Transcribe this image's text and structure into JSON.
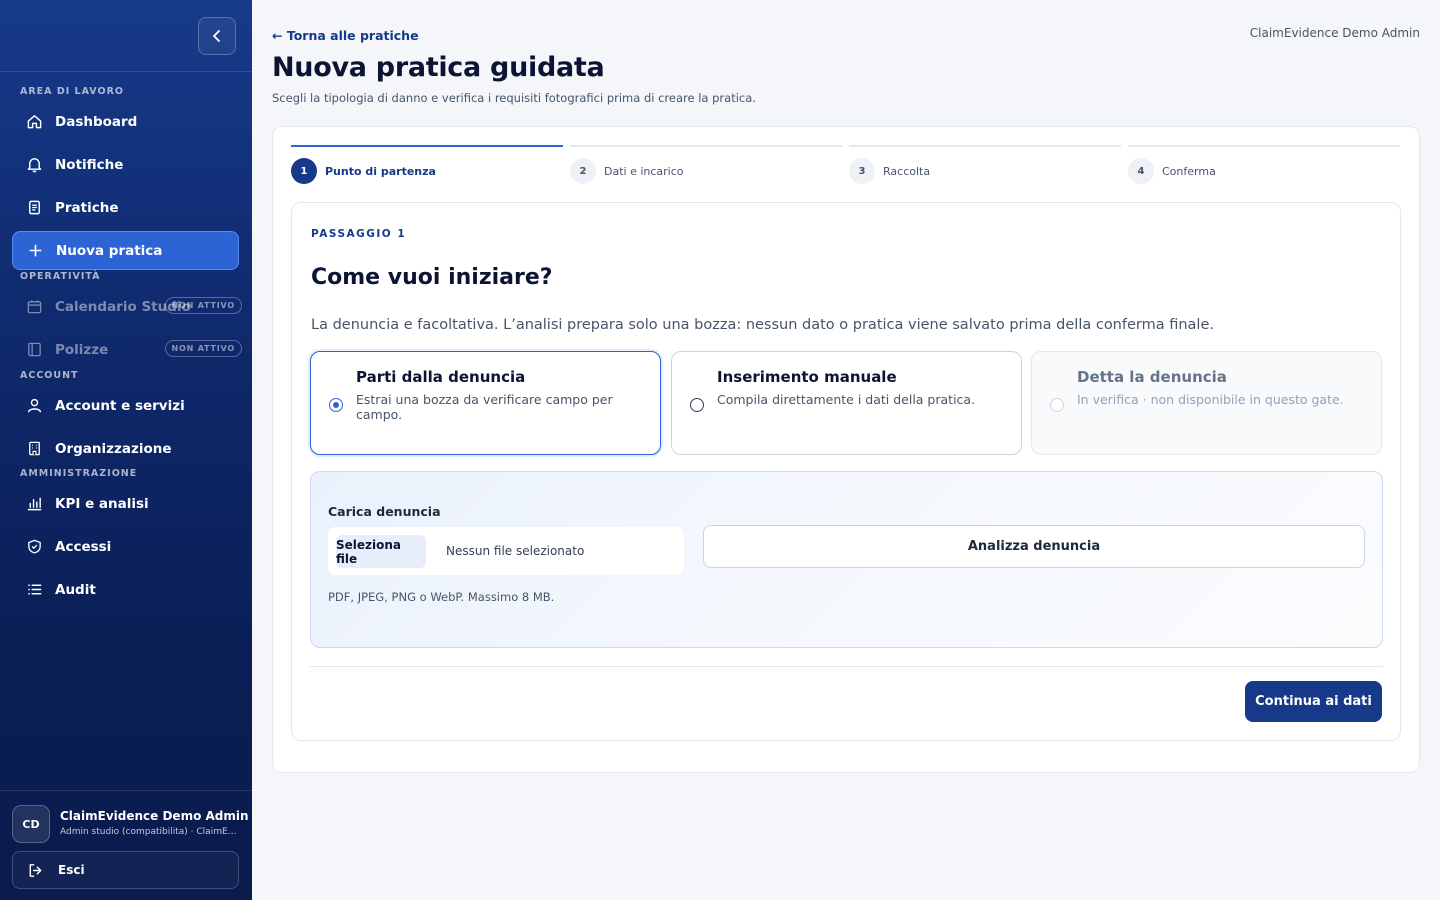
{
  "sidebar": {
    "collapse_icon": "chevron-left-icon",
    "sections": {
      "workspace": "AREA DI LAVORO",
      "operations": "OPERATIVITÀ",
      "account": "ACCOUNT",
      "admin": "AMMINISTRAZIONE"
    },
    "items": [
      {
        "label": "Dashboard",
        "icon": "home-icon"
      },
      {
        "label": "Notifiche",
        "icon": "bell-icon"
      },
      {
        "label": "Pratiche",
        "icon": "document-icon"
      },
      {
        "label": "Nuova pratica",
        "icon": "plus-icon",
        "active": true
      },
      {
        "label": "Calendario Studio",
        "icon": "calendar-icon",
        "badge": "NON ATTIVO"
      },
      {
        "label": "Polizze",
        "icon": "policy-icon",
        "badge": "NON ATTIVO"
      },
      {
        "label": "Account e servizi",
        "icon": "user-icon"
      },
      {
        "label": "Organizzazione",
        "icon": "building-icon"
      },
      {
        "label": "KPI e analisi",
        "icon": "bar-chart-icon"
      },
      {
        "label": "Accessi",
        "icon": "shield-icon"
      },
      {
        "label": "Audit",
        "icon": "list-icon"
      }
    ],
    "user": {
      "initials": "CD",
      "name": "ClaimEvidence Demo Admin",
      "role": "Admin studio (compatibilita) · ClaimEvidence"
    },
    "logout_label": "Esci"
  },
  "header": {
    "back_link": "← Torna alle pratiche",
    "user": "ClaimEvidence Demo Admin",
    "title": "Nuova pratica guidata",
    "subtitle": "Scegli la tipologia di danno e verifica i requisiti fotografici prima di creare la pratica."
  },
  "steps": [
    {
      "num": "1",
      "label": "Punto di partenza",
      "active": true
    },
    {
      "num": "2",
      "label": "Dati e incarico"
    },
    {
      "num": "3",
      "label": "Raccolta"
    },
    {
      "num": "4",
      "label": "Conferma"
    }
  ],
  "wizard": {
    "kicker": "PASSAGGIO 1",
    "heading": "Come vuoi iniziare?",
    "description": "La denuncia e facoltativa. L’analisi prepara solo una bozza: nessun dato o pratica viene salvato prima della conferma finale.",
    "options": [
      {
        "title": "Parti dalla denuncia",
        "desc": "Estrai una bozza da verificare campo per campo.",
        "selected": true
      },
      {
        "title": "Inserimento manuale",
        "desc": "Compila direttamente i dati della pratica."
      },
      {
        "title": "Detta la denuncia",
        "desc": "In verifica · non disponibile in questo gate.",
        "disabled": true
      }
    ],
    "upload": {
      "label": "Carica denuncia",
      "file_button": "Seleziona file",
      "file_name": "Nessun file selezionato",
      "analyze_button": "Analizza denuncia",
      "hint": "PDF, JPEG, PNG o WebP. Massimo 8 MB."
    },
    "continue_button": "Continua ai dati"
  },
  "colors": {
    "accent": "#2c64d6",
    "brand_dark": "#17398a",
    "sidebar_bg": "#0f2a6e"
  }
}
